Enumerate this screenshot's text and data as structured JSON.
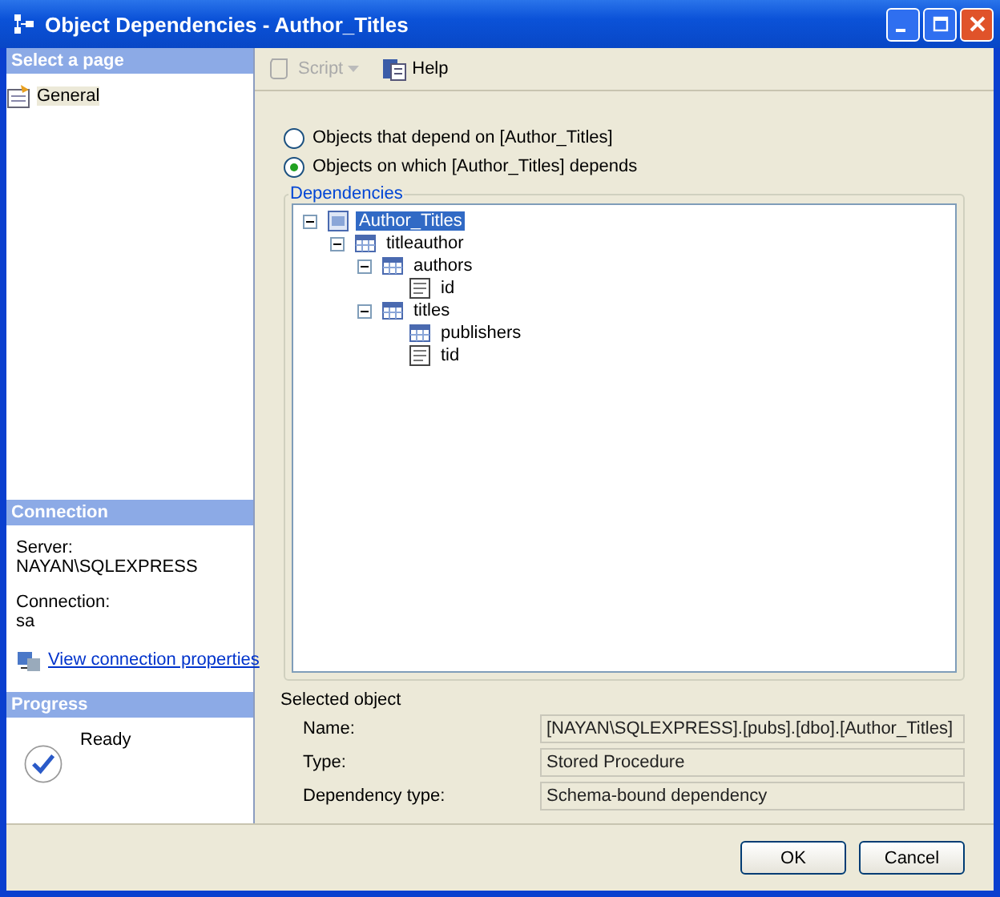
{
  "window": {
    "title": "Object Dependencies - Author_Titles"
  },
  "sidebar": {
    "header": "Select a page",
    "items": [
      {
        "label": "General",
        "selected": true
      }
    ]
  },
  "connection": {
    "header": "Connection",
    "server_label": "Server:",
    "server": "NAYAN\\SQLEXPRESS",
    "connection_label": "Connection:",
    "connection": "sa",
    "link": "View connection properties"
  },
  "progress": {
    "header": "Progress",
    "status": "Ready"
  },
  "toolbar": [
    {
      "label": "Script",
      "disabled": true,
      "dropdown": true
    },
    {
      "label": "Help",
      "disabled": false,
      "dropdown": false
    }
  ],
  "options": [
    {
      "label": "Objects that depend on [Author_Titles]",
      "selected": false
    },
    {
      "label": "Objects on which [Author_Titles] depends",
      "selected": true
    }
  ],
  "dependencies": {
    "title": "Dependencies",
    "tree": [
      {
        "label": "Author_Titles",
        "kind": "procedure",
        "expanded": true,
        "selected": true,
        "children": [
          {
            "label": "titleauthor",
            "kind": "table",
            "expanded": true,
            "selected": false,
            "children": [
              {
                "label": "authors",
                "kind": "table",
                "expanded": true,
                "selected": false,
                "children": [
                  {
                    "label": "id",
                    "kind": "column",
                    "selected": false
                  }
                ]
              },
              {
                "label": "titles",
                "kind": "table",
                "expanded": true,
                "selected": false,
                "children": [
                  {
                    "label": "publishers",
                    "kind": "table",
                    "selected": false
                  },
                  {
                    "label": "tid",
                    "kind": "column",
                    "selected": false
                  }
                ]
              }
            ]
          }
        ]
      }
    ]
  },
  "selected_object": {
    "title": "Selected object",
    "fields": [
      {
        "label": "Name:",
        "value": "[NAYAN\\SQLEXPRESS].[pubs].[dbo].[Author_Titles]"
      },
      {
        "label": "Type:",
        "value": "Stored Procedure"
      },
      {
        "label": "Dependency type:",
        "value": "Schema-bound dependency"
      }
    ]
  },
  "buttons": [
    "OK",
    "Cancel"
  ]
}
